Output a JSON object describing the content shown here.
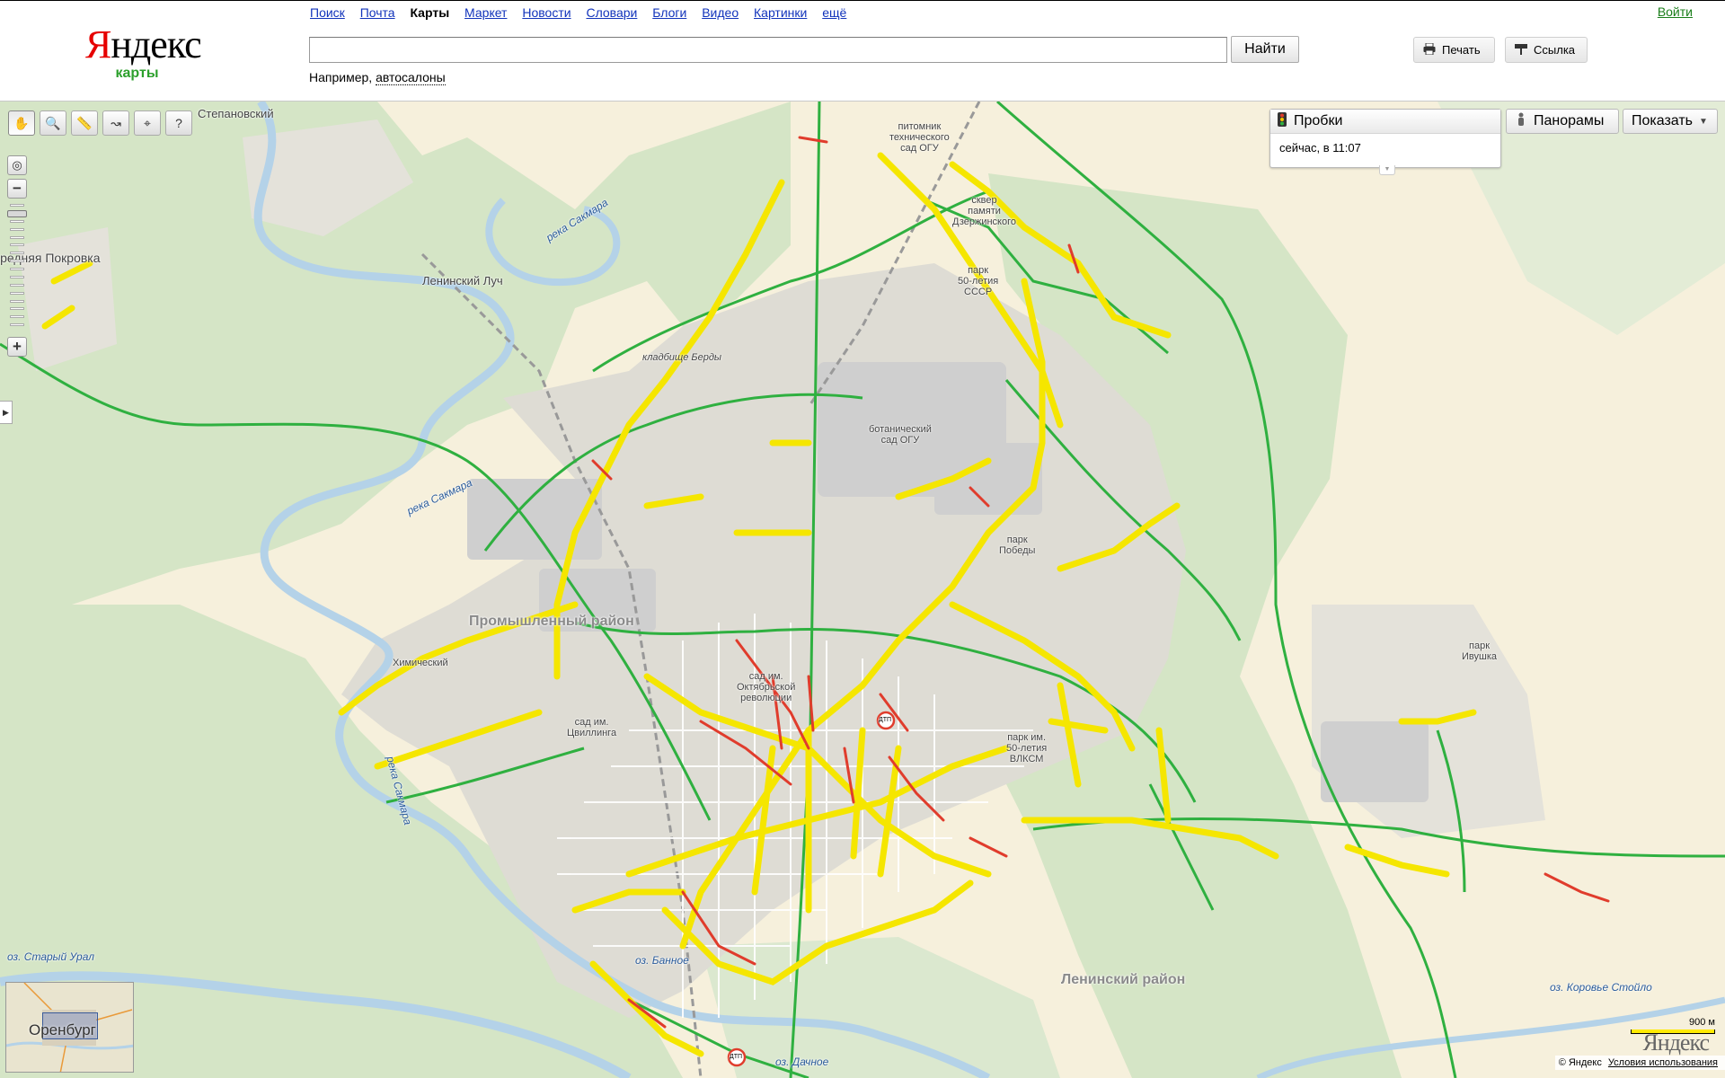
{
  "brand": {
    "logo": "Яндекс",
    "logo_first": "Я",
    "logo_rest": "ндекс",
    "section": "карты",
    "corner_logo": "Яндекс"
  },
  "nav": {
    "items": [
      "Поиск",
      "Почта",
      "Карты",
      "Маркет",
      "Новости",
      "Словари",
      "Блоги",
      "Видео",
      "Картинки",
      "ещё"
    ],
    "active": "Карты",
    "login": "Войти"
  },
  "search": {
    "value": "",
    "button": "Найти",
    "example_prefix": "Например, ",
    "example_link": "автосалоны"
  },
  "header_buttons": {
    "print": "Печать",
    "link": "Ссылка"
  },
  "map_controls": {
    "tools": [
      "hand-icon",
      "zoom-area-icon",
      "ruler-icon",
      "route-icon",
      "mark-icon",
      "info-icon"
    ],
    "zoom_in": "+",
    "zoom_out": "−",
    "zoom_level_fraction": 0.92
  },
  "layers": {
    "traffic_title": "Пробки",
    "traffic_time": "сейчас, в 11:07",
    "panorama": "Панорамы",
    "show": "Показать"
  },
  "map_labels": {
    "stepanovsky": "Степановский",
    "pokrovka": "Средняя Покровка",
    "leninsky_luch": "Ленинский Луч",
    "kladbishche": "кладбище Берды",
    "reka_sakmara_1": "река Сакмара",
    "reka_sakmara_2": "река Сакмара",
    "reka_sakmara_3": "река Сакмара",
    "pitomnik": "питомник\nтехнического\nсад ОГУ",
    "skver": "сквер\nпамяти\nДзержинского",
    "park_50": "парк\n50-летия\nСССР",
    "botanic": "ботанический\nсад ОГУ",
    "park_pobedy": "парк\nПобеды",
    "promyshlenny": "Промышленный район",
    "khimichesky": "Химический",
    "sad_tsvillinga": "сад им.\nЦвиллинга",
    "sad_oktyabr": "сад им.\nОктябрьской\nреволюции",
    "park_vlksm": "парк им.\n50-летия\nВЛКСМ",
    "park_ivushka": "парк\nИвушка",
    "leninsky_rayon": "Ленинский район",
    "oz_stary_ural": "оз. Старый Урал",
    "oz_dachnoe": "оз. Дачное",
    "oz_korovye": "оз. Коровье Стойло",
    "oz_ban": "оз. Банное",
    "dtp": "ДТП"
  },
  "minimap": {
    "city": "Оренбург"
  },
  "scale": {
    "label": "900 м"
  },
  "footer": {
    "copyright": "© Яндекс",
    "terms": "Условия использования"
  },
  "colors": {
    "traffic_free": "#2fb040",
    "traffic_slow": "#f5e600",
    "traffic_jam": "#e03c2c",
    "map_bg": "#f6f0dc",
    "forest": "#d6e6c8",
    "river": "#b4d2e8",
    "urban": "#dcdad4"
  }
}
